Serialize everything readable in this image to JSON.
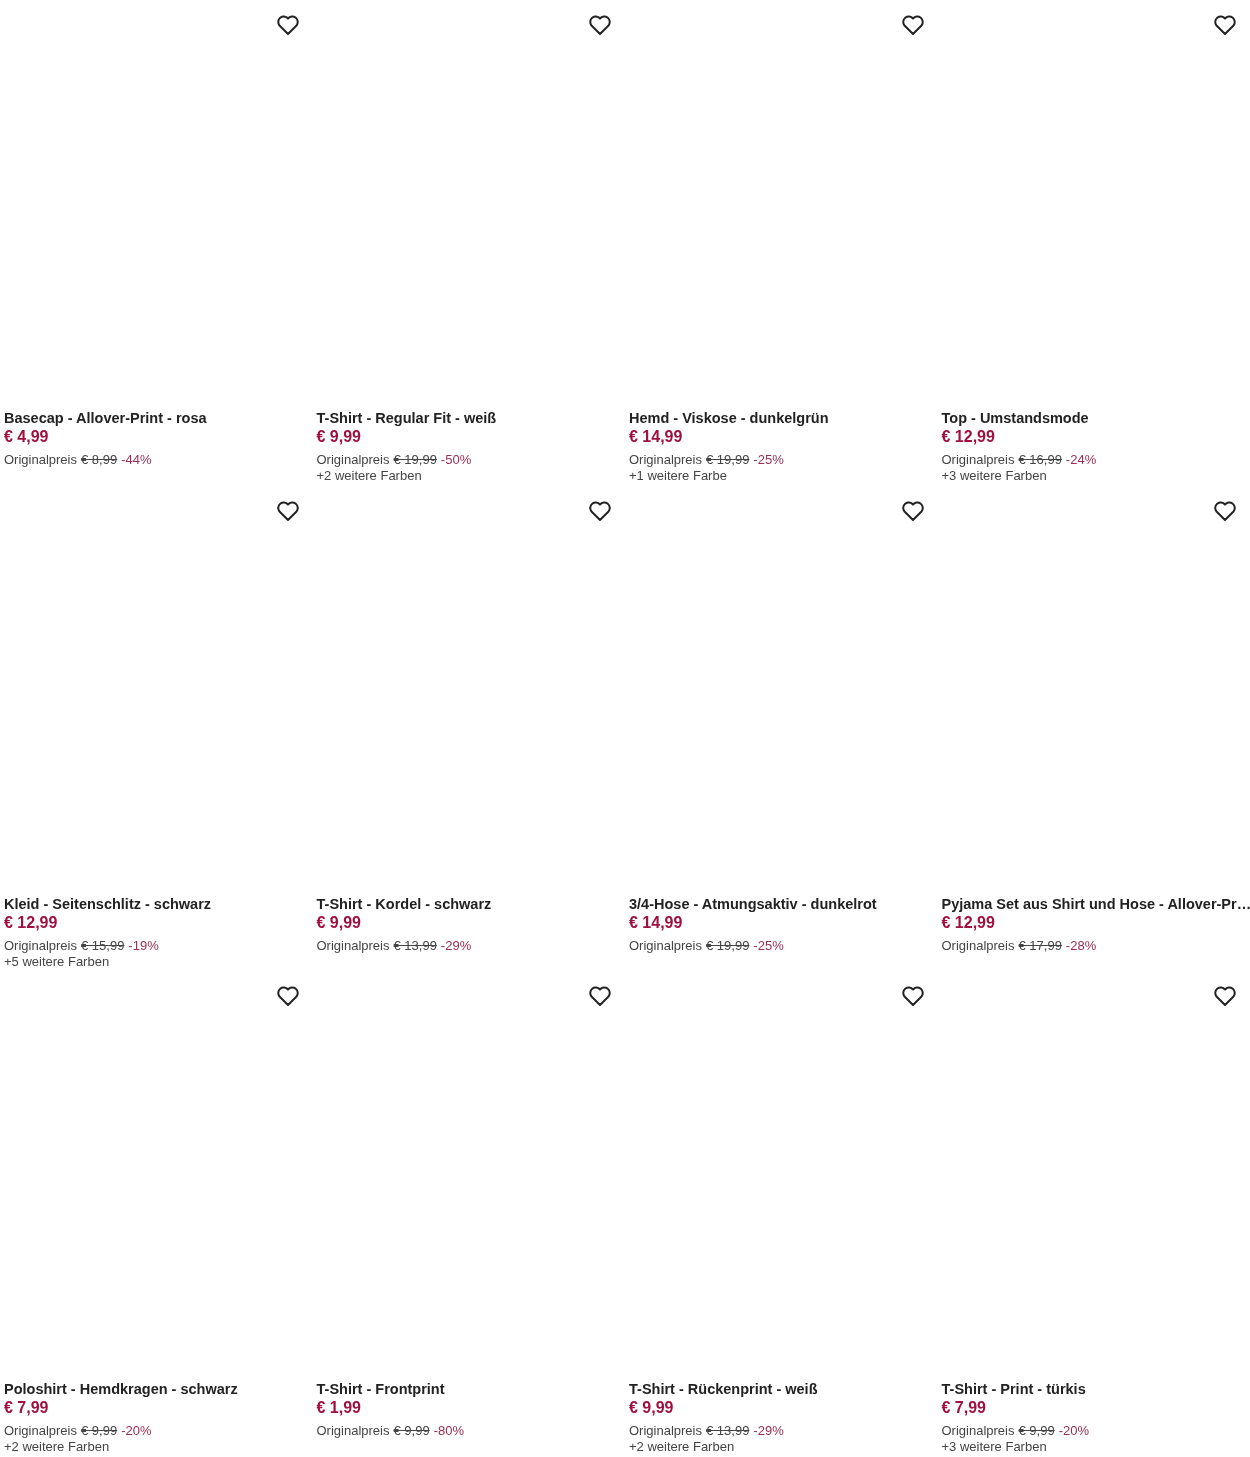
{
  "products": [
    {
      "title": "Basecap - Allover-Print - rosa",
      "price": "€ 4,99",
      "original_label": "Originalpreis",
      "original_price": "€ 8,99",
      "discount": "-44%"
    },
    {
      "title": "T-Shirt - Regular Fit - weiß",
      "price": "€ 9,99",
      "original_label": "Originalpreis",
      "original_price": "€ 19,99",
      "discount": "-50%",
      "colors": "+2 weitere Farben"
    },
    {
      "title": "Hemd - Viskose - dunkelgrün",
      "price": "€ 14,99",
      "original_label": "Originalpreis",
      "original_price": "€ 19,99",
      "discount": "-25%",
      "colors": "+1 weitere Farbe"
    },
    {
      "title": "Top - Umstandsmode",
      "price": "€ 12,99",
      "original_label": "Originalpreis",
      "original_price": "€ 16,99",
      "discount": "-24%",
      "colors": "+3 weitere Farben"
    },
    {
      "title": "Kleid - Seitenschlitz - schwarz",
      "price": "€ 12,99",
      "original_label": "Originalpreis",
      "original_price": "€ 15,99",
      "discount": "-19%",
      "colors": "+5 weitere Farben"
    },
    {
      "title": "T-Shirt - Kordel - schwarz",
      "price": "€ 9,99",
      "original_label": "Originalpreis",
      "original_price": "€ 13,99",
      "discount": "-29%"
    },
    {
      "title": "3/4-Hose - Atmungsaktiv - dunkelrot",
      "price": "€ 14,99",
      "original_label": "Originalpreis",
      "original_price": "€ 19,99",
      "discount": "-25%"
    },
    {
      "title": "Pyjama Set aus Shirt und Hose - Allover-Pr…",
      "price": "€ 12,99",
      "original_label": "Originalpreis",
      "original_price": "€ 17,99",
      "discount": "-28%"
    },
    {
      "title": "Poloshirt - Hemdkragen - schwarz",
      "price": "€ 7,99",
      "original_label": "Originalpreis",
      "original_price": "€ 9,99",
      "discount": "-20%",
      "colors": "+2 weitere Farben"
    },
    {
      "title": "T-Shirt - Frontprint",
      "price": "€ 1,99",
      "original_label": "Originalpreis",
      "original_price": "€ 9,99",
      "discount": "-80%"
    },
    {
      "title": "T-Shirt - Rückenprint - weiß",
      "price": "€ 9,99",
      "original_label": "Originalpreis",
      "original_price": "€ 13,99",
      "discount": "-29%",
      "colors": "+2 weitere Farben"
    },
    {
      "title": "T-Shirt - Print - türkis",
      "price": "€ 7,99",
      "original_label": "Originalpreis",
      "original_price": "€ 9,99",
      "discount": "-20%",
      "colors": "+3 weitere Farben"
    }
  ]
}
